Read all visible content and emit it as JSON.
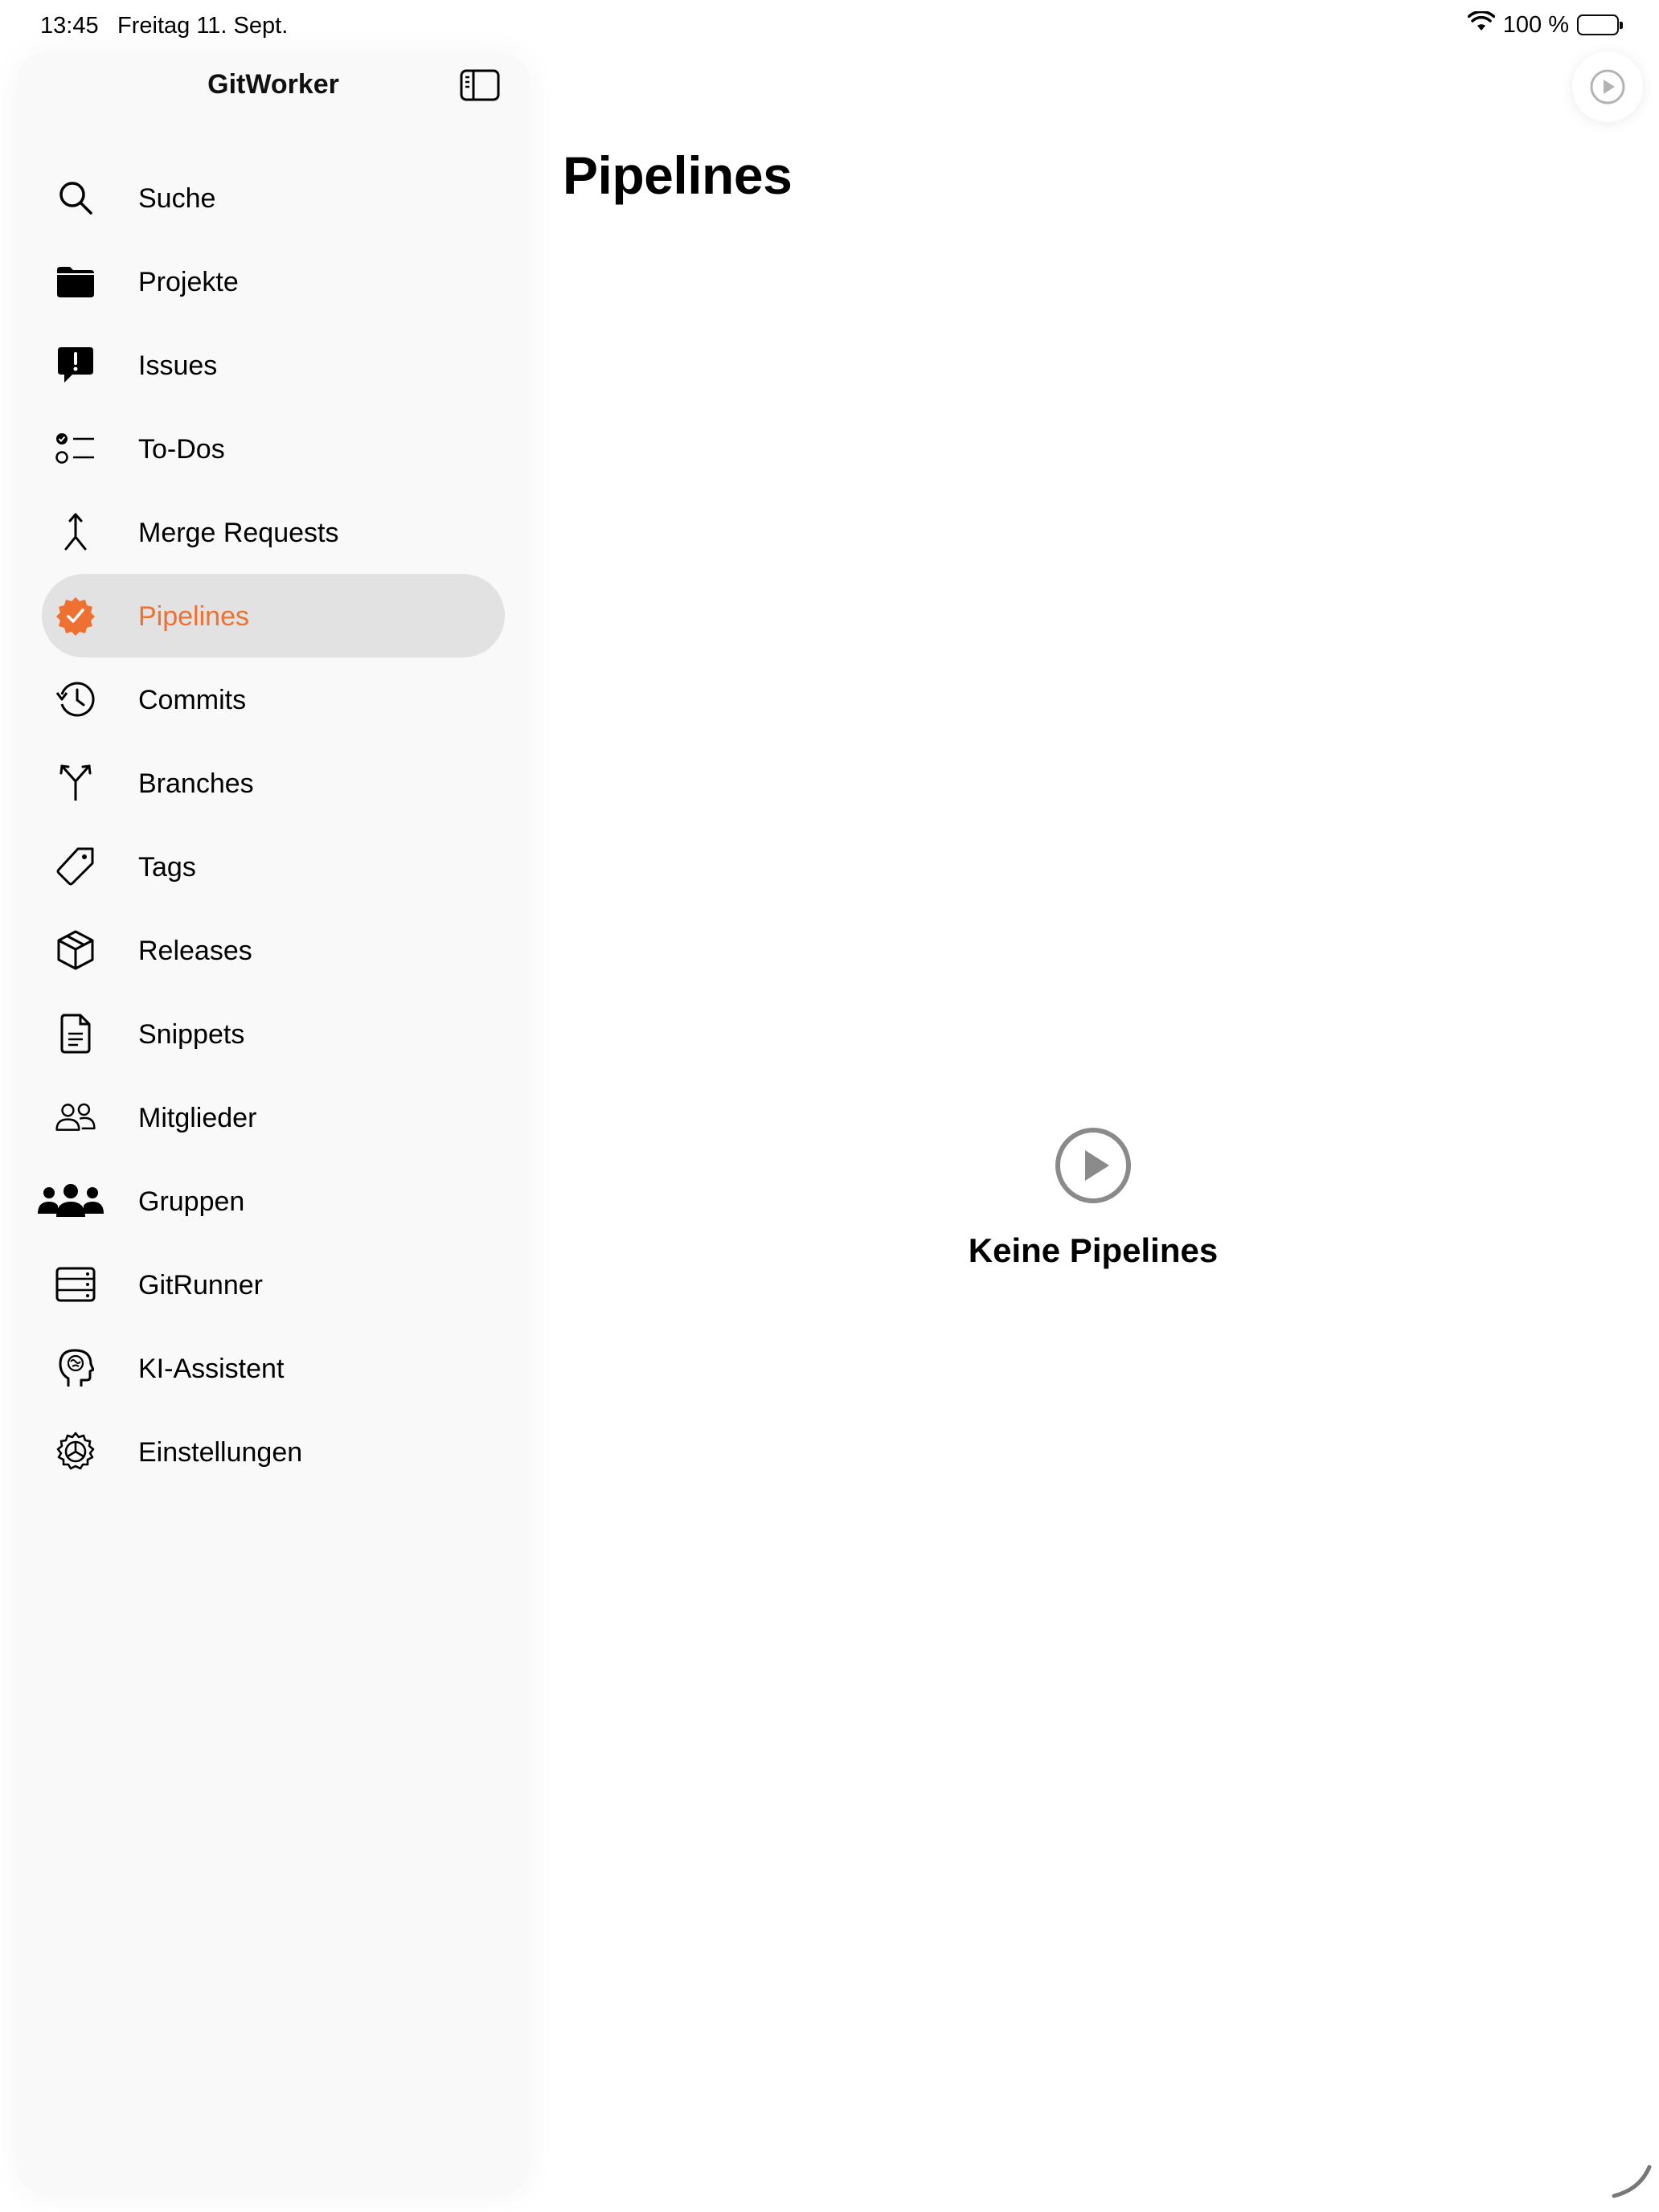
{
  "status_bar": {
    "time": "13:45",
    "date": "Freitag 11. Sept.",
    "battery_percent": "100 %"
  },
  "sidebar": {
    "title": "GitWorker",
    "items": [
      {
        "label": "Suche",
        "icon": "magnifyingglass-icon"
      },
      {
        "label": "Projekte",
        "icon": "folder-icon"
      },
      {
        "label": "Issues",
        "icon": "exclamation-bubble-icon"
      },
      {
        "label": "To-Dos",
        "icon": "checklist-icon"
      },
      {
        "label": "Merge Requests",
        "icon": "merge-icon"
      },
      {
        "label": "Pipelines",
        "icon": "checkmark-seal-icon",
        "active": true
      },
      {
        "label": "Commits",
        "icon": "history-icon"
      },
      {
        "label": "Branches",
        "icon": "branch-icon"
      },
      {
        "label": "Tags",
        "icon": "tag-icon"
      },
      {
        "label": "Releases",
        "icon": "shipping-box-icon"
      },
      {
        "label": "Snippets",
        "icon": "document-icon"
      },
      {
        "label": "Mitglieder",
        "icon": "people-icon"
      },
      {
        "label": "Gruppen",
        "icon": "group-icon"
      },
      {
        "label": "GitRunner",
        "icon": "server-rack-icon"
      },
      {
        "label": "KI-Assistent",
        "icon": "brain-head-icon"
      },
      {
        "label": "Einstellungen",
        "icon": "gear-icon"
      }
    ]
  },
  "main": {
    "title": "Pipelines",
    "empty_state": {
      "title": "Keine Pipelines",
      "icon": "play-circle-icon"
    },
    "top_action_icon": "play-circle-icon"
  },
  "colors": {
    "accent": "#ee7131",
    "sidebar_bg": "#f9f9f9",
    "selected_bg": "#e2e2e2",
    "empty_icon": "#8a8a8a"
  }
}
